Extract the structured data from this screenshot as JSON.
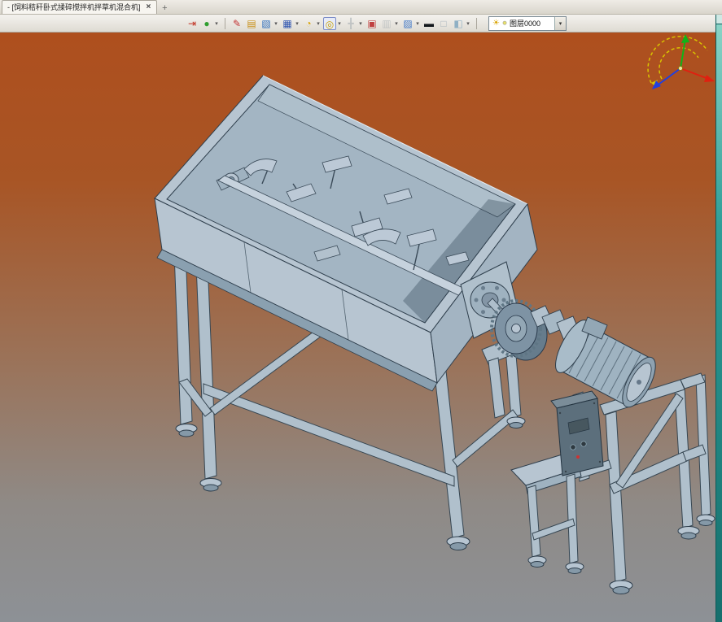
{
  "window": {
    "tab_title": "- [饲料秸秆卧式揉碎搅拌机拌草机混合机]",
    "tab_close_glyph": "×",
    "new_tab_glyph": "+"
  },
  "toolbar": {
    "dropdown_glyph": "▾",
    "icons": [
      {
        "name": "exit-icon",
        "glyph": "⇥",
        "color": "#c03020",
        "disabled": false,
        "has_dropdown": false
      },
      {
        "name": "render-mode-icon",
        "glyph": "●",
        "color": "#2f9e2f",
        "disabled": false,
        "has_dropdown": true
      },
      {
        "name": "sketch-pen-icon",
        "glyph": "✎",
        "color": "#c23333",
        "disabled": false,
        "has_dropdown": false
      },
      {
        "name": "palette-icon",
        "glyph": "▤",
        "color": "#c89018",
        "disabled": false,
        "has_dropdown": false
      },
      {
        "name": "solid-modeling-icon",
        "glyph": "▧",
        "color": "#3070c0",
        "disabled": false,
        "has_dropdown": true
      },
      {
        "name": "assembly-icon",
        "glyph": "▦",
        "color": "#2f55b0",
        "disabled": false,
        "has_dropdown": true
      },
      {
        "name": "pie-analysis-icon",
        "glyph": "◔",
        "color": "#d9a300",
        "disabled": false,
        "has_dropdown": true
      },
      {
        "name": "zoom-icon",
        "glyph": "◎",
        "color": "#c8a000",
        "disabled": false,
        "has_dropdown": true,
        "active": true
      },
      {
        "name": "move-view-icon",
        "glyph": "╋",
        "color": "#9fa8ad",
        "disabled": true,
        "has_dropdown": true
      },
      {
        "name": "render-region-icon",
        "glyph": "▣",
        "color": "#c04040",
        "disabled": false,
        "has_dropdown": false
      },
      {
        "name": "grid-icon",
        "glyph": "▥",
        "color": "#9fa8ad",
        "disabled": true,
        "has_dropdown": true
      },
      {
        "name": "image-icon",
        "glyph": "▨",
        "color": "#4078c8",
        "disabled": false,
        "has_dropdown": true
      },
      {
        "name": "line-width-icon",
        "glyph": "▬",
        "color": "#14181c",
        "disabled": false,
        "has_dropdown": false
      },
      {
        "name": "bg-color-icon",
        "glyph": "□",
        "color": "#aab6bd",
        "disabled": false,
        "has_dropdown": false
      },
      {
        "name": "material-icon",
        "glyph": "◧",
        "color": "#8fb0c4",
        "disabled": false,
        "has_dropdown": true
      }
    ],
    "layer": {
      "bulb_glyph": "☀",
      "swatch_glyph": "●",
      "value": "图层0000",
      "dropdown_glyph": "▾"
    }
  },
  "viewport": {
    "background_top": "#ae4f1e",
    "background_bottom": "#8d9196",
    "scrollbar_color": "#2e9e98"
  },
  "triad": {
    "x_color": "#e02010",
    "y_color": "#10b418",
    "z_color": "#2040e0",
    "arc_color": "#d8c400"
  },
  "model": {
    "body_color": "#b7c5d1",
    "interior_color": "#a3b5c3",
    "shadow_color": "#8599a8",
    "outline_color": "#2e3e4c",
    "control_box_color": "#5c6f7c"
  }
}
